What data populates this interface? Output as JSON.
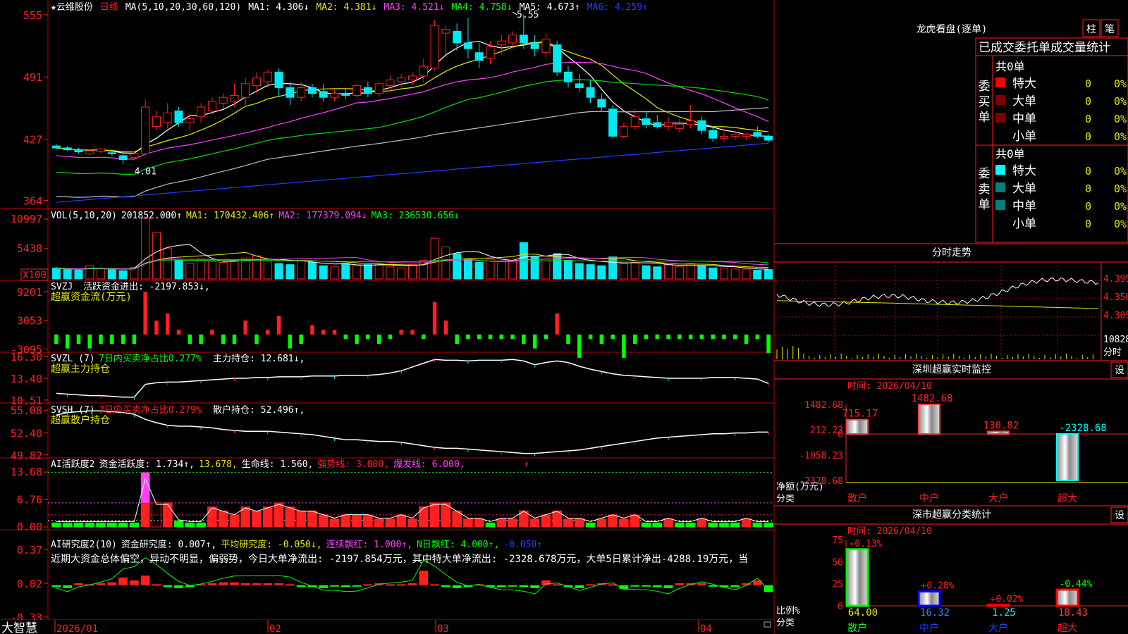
{
  "colors": {
    "up": "#ff2020",
    "down": "#00e8f0",
    "grid": "#c00000",
    "white": "#ffffff",
    "yellow": "#e8e800",
    "magenta": "#ff40ff",
    "green": "#00e000",
    "gray": "#c0c0c0",
    "blue": "#2040ff",
    "bright_green": "#00ff00"
  },
  "price_panel": {
    "title": "★云维股份",
    "period": "日线",
    "ma_head": "MA(5,10,20,30,60,120)",
    "ma1": "MA1: 4.306↓",
    "ma2": "MA2: 4.381↓",
    "ma3": "MA3: 4.521↓",
    "ma4": "MA4: 4.758↓",
    "ma5": "MA5: 4.673↑",
    "ma6": "MA6: 4.259↑",
    "high_mark": "5.55",
    "low_mark": "4.01",
    "ticks": [
      "555",
      "491",
      "427",
      "364"
    ]
  },
  "vol_panel": {
    "head": "VOL(5,10,20)",
    "value": "201852.000↑",
    "ma1": "MA1: 170432.406↑",
    "ma2": "MA2: 177379.094↓",
    "ma3": "MA3: 236530.656↓",
    "ticks": [
      "10997",
      "5430"
    ],
    "unit": "X100"
  },
  "svzj_panel": {
    "head": "SVZJ",
    "text": "活跃资金进出: -2197.853↓,",
    "sub": "超赢资金流(万元)",
    "ticks": [
      "9201",
      "3053",
      "-3095"
    ]
  },
  "svzl_panel": {
    "head": "SVZL (7)",
    "text1": "7日内买卖净占比0.277%",
    "text2": "主力持仓: 12.681↓,",
    "sub": "超赢主力持仓",
    "ticks": [
      "16.30",
      "13.40",
      "10.51"
    ]
  },
  "svsh_panel": {
    "head": "SVSH (7)",
    "text1": "7日内买卖净占比0.279%",
    "text2": "散户持仓: 52.496↑,",
    "sub": "超赢散户持仓",
    "ticks": [
      "55.08",
      "52.40",
      "49.82"
    ]
  },
  "ai_panel": {
    "head": "AI活跃度2",
    "t1": "资金活跃度: 1.734↑,",
    "t2": "13.678,",
    "t3": "生命线: 1.560,",
    "t4": "强势线: 3.000,",
    "t5": "爆发线: 6.000,",
    "ticks": [
      "13.68",
      "6.76",
      "0.00"
    ]
  },
  "ai2_panel": {
    "head": "AI研究度2(10)",
    "t1": "资金研究度: 0.007↑,",
    "t2": "平均研究度: -0.050↓,",
    "t3": "连续飘红: 1.000↑,",
    "t4": "N日飘红: 4.000↑,",
    "t5": "-0.050↑",
    "desc": "近期大资金总体偏空，异动不明显，偏弱势，今日大单净流出: -2197.854万元，其中特大单净流出: -2328.678万元，大单5日累计净出-4288.19万元，当",
    "ticks": [
      "0.37",
      "0.02",
      "-0.33"
    ]
  },
  "bottom": {
    "logo": "大智慧",
    "dates": [
      "2026/01",
      "02",
      "03",
      "04"
    ]
  },
  "lhb": {
    "title": "龙虎看盘(逐单)",
    "btn1": "柱",
    "btn2": "笔",
    "subtitle": "已成交委托单成交量统计",
    "buy": {
      "label": "委买单",
      "total": "共0单",
      "rows": [
        {
          "name": "特大",
          "v": "0",
          "p": "0%"
        },
        {
          "name": "大单",
          "v": "0",
          "p": "0%"
        },
        {
          "name": "中单",
          "v": "0",
          "p": "0%"
        },
        {
          "name": "小单",
          "v": "0",
          "p": "0%"
        }
      ]
    },
    "sell": {
      "label": "委卖单",
      "total": "共0单",
      "rows": [
        {
          "name": "特大",
          "v": "0",
          "p": "0%"
        },
        {
          "name": "大单",
          "v": "0",
          "p": "0%"
        },
        {
          "name": "中单",
          "v": "0",
          "p": "0%"
        },
        {
          "name": "小单",
          "v": "0",
          "p": "0%"
        }
      ]
    }
  },
  "intraday": {
    "title": "分时走势",
    "ticks": [
      "4.395",
      "4.350",
      "4.305"
    ],
    "vol_tick": "10828",
    "unit": "分时"
  },
  "sz_monitor": {
    "title": "深圳超赢实时监控",
    "set": "设",
    "time": "时间: 2026/04/10",
    "ylabel": "净额(万元)",
    "xlabel": "分类",
    "ticks": [
      "1482.68",
      "212.23",
      "0",
      "-1058.23",
      "-2328.68"
    ],
    "cats": [
      "散户",
      "中户",
      "大户",
      "超大"
    ],
    "labels": [
      "715.17",
      "1482.68",
      "130.82",
      "-2328.68"
    ]
  },
  "sz_class": {
    "title": "深市超赢分类统计",
    "set": "设",
    "time": "时间: 2026/04/10",
    "ylabel": "比例%",
    "xlabel": "分类",
    "ticks": [
      "75",
      "50",
      "25",
      "0"
    ],
    "cats": [
      "散户",
      "中户",
      "大户",
      "超大"
    ],
    "top_labels": [
      "+0.13%",
      "+0.28%",
      "+0.02%",
      "-0.44%"
    ],
    "bottom_labels": [
      "64.00",
      "16.32",
      "1.25",
      "18.43"
    ]
  },
  "chart_data": [
    {
      "type": "candlestick",
      "name": "price",
      "ohlc": [
        [
          4.2,
          4.22,
          4.17,
          4.18
        ],
        [
          4.18,
          4.2,
          4.15,
          4.16
        ],
        [
          4.16,
          4.18,
          4.12,
          4.14
        ],
        [
          4.12,
          4.16,
          4.1,
          4.15
        ],
        [
          4.14,
          4.18,
          4.12,
          4.17
        ],
        [
          4.13,
          4.16,
          4.1,
          4.12
        ],
        [
          4.1,
          4.12,
          4.01,
          4.06
        ],
        [
          4.08,
          4.14,
          4.06,
          4.12
        ],
        [
          4.12,
          4.68,
          4.1,
          4.6
        ],
        [
          4.4,
          4.56,
          4.36,
          4.5
        ],
        [
          4.44,
          4.64,
          4.38,
          4.54
        ],
        [
          4.56,
          4.6,
          4.4,
          4.44
        ],
        [
          4.44,
          4.54,
          4.36,
          4.48
        ],
        [
          4.5,
          4.64,
          4.44,
          4.6
        ],
        [
          4.56,
          4.7,
          4.52,
          4.66
        ],
        [
          4.64,
          4.74,
          4.58,
          4.7
        ],
        [
          4.66,
          4.84,
          4.6,
          4.72
        ],
        [
          4.7,
          4.9,
          4.62,
          4.84
        ],
        [
          4.82,
          4.96,
          4.74,
          4.9
        ],
        [
          4.86,
          4.98,
          4.8,
          4.96
        ],
        [
          4.96,
          5.0,
          4.7,
          4.8
        ],
        [
          4.8,
          4.86,
          4.62,
          4.7
        ],
        [
          4.7,
          4.86,
          4.66,
          4.8
        ],
        [
          4.8,
          4.84,
          4.7,
          4.74
        ],
        [
          4.76,
          4.84,
          4.66,
          4.7
        ],
        [
          4.7,
          4.78,
          4.66,
          4.74
        ],
        [
          4.74,
          4.8,
          4.68,
          4.72
        ],
        [
          4.72,
          4.84,
          4.7,
          4.82
        ],
        [
          4.8,
          4.86,
          4.7,
          4.74
        ],
        [
          4.74,
          4.86,
          4.7,
          4.84
        ],
        [
          4.82,
          4.92,
          4.76,
          4.88
        ],
        [
          4.86,
          4.94,
          4.8,
          4.9
        ],
        [
          4.88,
          4.96,
          4.82,
          4.92
        ],
        [
          4.92,
          5.1,
          4.86,
          5.02
        ],
        [
          5.0,
          5.5,
          4.98,
          5.44
        ],
        [
          5.36,
          5.44,
          5.14,
          5.4
        ],
        [
          5.38,
          5.46,
          5.18,
          5.26
        ],
        [
          5.26,
          5.52,
          5.1,
          5.2
        ],
        [
          5.16,
          5.26,
          5.0,
          5.08
        ],
        [
          5.1,
          5.28,
          5.04,
          5.22
        ],
        [
          5.24,
          5.34,
          5.14,
          5.28
        ],
        [
          5.26,
          5.38,
          5.2,
          5.34
        ],
        [
          5.34,
          5.55,
          5.2,
          5.26
        ],
        [
          5.26,
          5.34,
          5.12,
          5.2
        ],
        [
          5.16,
          5.36,
          5.1,
          5.3
        ],
        [
          5.24,
          5.28,
          4.92,
          4.96
        ],
        [
          4.96,
          5.02,
          4.8,
          4.86
        ],
        [
          4.84,
          4.94,
          4.76,
          4.8
        ],
        [
          4.8,
          4.88,
          4.64,
          4.7
        ],
        [
          4.68,
          4.74,
          4.56,
          4.6
        ],
        [
          4.58,
          4.62,
          4.28,
          4.3
        ],
        [
          4.3,
          4.44,
          4.28,
          4.4
        ],
        [
          4.4,
          4.58,
          4.36,
          4.5
        ],
        [
          4.48,
          4.56,
          4.38,
          4.42
        ],
        [
          4.44,
          4.52,
          4.38,
          4.4
        ],
        [
          4.4,
          4.5,
          4.36,
          4.44
        ],
        [
          4.38,
          4.48,
          4.34,
          4.42
        ],
        [
          4.42,
          4.62,
          4.38,
          4.46
        ],
        [
          4.46,
          4.5,
          4.32,
          4.36
        ],
        [
          4.36,
          4.4,
          4.24,
          4.28
        ],
        [
          4.28,
          4.34,
          4.24,
          4.3
        ],
        [
          4.3,
          4.36,
          4.26,
          4.32
        ],
        [
          4.3,
          4.34,
          4.26,
          4.32
        ],
        [
          4.34,
          4.4,
          4.28,
          4.3
        ],
        [
          4.3,
          4.32,
          4.24,
          4.26
        ]
      ],
      "ma_last": {
        "MA1": 4.306,
        "MA2": 4.381,
        "MA3": 4.521,
        "MA4": 4.758,
        "MA5": 4.673,
        "MA6": 4.259
      },
      "ylim": [
        3.6,
        5.6
      ]
    },
    {
      "type": "bar",
      "name": "volume",
      "values": [
        2.0,
        1.8,
        1.6,
        2.4,
        1.9,
        1.7,
        1.5,
        2.1,
        11.0,
        8.4,
        5.6,
        3.4,
        2.8,
        3.6,
        3.2,
        3.0,
        3.4,
        3.8,
        4.2,
        3.6,
        2.8,
        2.6,
        3.4,
        3.0,
        2.4,
        2.2,
        2.8,
        2.4,
        2.6,
        2.8,
        2.2,
        2.0,
        2.6,
        3.4,
        7.4,
        5.8,
        4.6,
        3.6,
        3.0,
        3.6,
        3.2,
        3.4,
        6.6,
        4.0,
        3.6,
        4.6,
        3.4,
        2.8,
        2.6,
        2.4,
        4.0,
        2.8,
        3.0,
        2.4,
        2.2,
        2.6,
        2.2,
        2.8,
        2.4,
        2.0,
        2.0,
        1.8,
        1.8,
        1.6,
        1.7
      ],
      "ylim": [
        0,
        11.5
      ]
    },
    {
      "type": "bar",
      "name": "svzj",
      "values": [
        -2,
        -3,
        -2,
        -3,
        -2,
        -2,
        -2,
        -2,
        9.2,
        3,
        4.5,
        1,
        -2,
        -2,
        1,
        -2,
        -2,
        3,
        -2,
        1,
        4,
        -3,
        -2,
        2,
        1,
        1,
        -1,
        -2,
        -1,
        -2,
        -1,
        1,
        1,
        -1,
        7,
        3,
        -2,
        -1,
        -1,
        -1,
        -1,
        -1,
        -2,
        -3,
        -1,
        4.5,
        -2,
        -5,
        -1,
        -2,
        -1,
        -5,
        -2,
        -1,
        -1,
        -1,
        -1,
        -1,
        -1,
        -1,
        -1,
        -1,
        -2,
        -1,
        -4
      ],
      "ylim": [
        -3.5,
        9.5
      ]
    },
    {
      "type": "line",
      "name": "svzl",
      "values": [
        11.4,
        11.3,
        11.2,
        11.1,
        11.1,
        11.0,
        10.9,
        10.9,
        12.6,
        12.8,
        12.9,
        12.9,
        13.0,
        13.1,
        13.2,
        13.3,
        13.4,
        13.4,
        13.5,
        13.5,
        13.6,
        13.6,
        13.6,
        13.7,
        13.7,
        13.7,
        13.8,
        13.8,
        13.8,
        13.9,
        14.1,
        14.4,
        14.9,
        15.4,
        15.9,
        15.8,
        15.8,
        15.7,
        15.8,
        15.8,
        15.8,
        15.9,
        15.7,
        15.2,
        15.5,
        15.7,
        15.5,
        15.0,
        14.6,
        14.3,
        14.0,
        13.8,
        13.7,
        13.6,
        13.5,
        13.4,
        13.4,
        13.4,
        13.4,
        13.5,
        13.5,
        13.5,
        13.4,
        13.3,
        12.7
      ],
      "ylim": [
        10.5,
        16.3
      ]
    },
    {
      "type": "line",
      "name": "svsh",
      "values": [
        54.5,
        54.8,
        54.9,
        55.0,
        55.0,
        54.9,
        54.8,
        54.6,
        54.0,
        53.6,
        53.3,
        53.2,
        53.2,
        53.1,
        53.0,
        52.8,
        52.7,
        52.6,
        52.6,
        52.6,
        52.5,
        52.4,
        52.3,
        52.2,
        52.0,
        51.8,
        51.6,
        51.6,
        51.5,
        51.4,
        51.4,
        51.3,
        51.1,
        50.9,
        50.7,
        50.6,
        50.6,
        50.5,
        50.4,
        50.3,
        50.2,
        50.1,
        50.0,
        50.0,
        50.1,
        50.2,
        50.3,
        50.4,
        50.6,
        50.8,
        51.0,
        51.2,
        51.4,
        51.6,
        51.8,
        51.9,
        52.0,
        52.1,
        52.2,
        52.3,
        52.3,
        52.4,
        52.4,
        52.5,
        52.5
      ],
      "ylim": [
        49.8,
        55.1
      ]
    },
    {
      "type": "bar",
      "name": "ai_activity",
      "values": [
        1,
        1,
        1,
        1,
        1,
        1,
        1,
        1,
        13.6,
        6,
        6,
        1.5,
        1,
        1,
        5,
        4,
        3,
        5,
        4,
        5,
        6,
        5,
        4,
        4,
        3,
        2,
        3,
        3,
        3,
        2,
        2,
        3,
        2,
        5,
        6,
        6,
        4,
        2,
        2,
        1,
        2,
        2,
        4,
        2,
        3,
        4,
        2,
        2,
        1,
        2,
        3,
        2,
        3,
        1,
        1,
        2,
        1,
        1,
        2,
        1,
        1,
        1,
        2,
        1,
        1
      ],
      "lines": {
        "life": 1.56,
        "strong": 3.0,
        "burst": 6.0
      },
      "ylim": [
        0,
        13.7
      ]
    },
    {
      "type": "bar",
      "name": "ai_research",
      "values": [
        -0.02,
        -0.03,
        0.02,
        0.01,
        0.02,
        0.03,
        0.08,
        0.05,
        0.1,
        0.01,
        -0.02,
        -0.03,
        -0.02,
        0.01,
        0.02,
        0.03,
        0.03,
        0.02,
        0.02,
        0.02,
        0.02,
        0.01,
        -0.02,
        -0.02,
        -0.03,
        -0.01,
        -0.02,
        -0.01,
        0.01,
        0.02,
        0.01,
        0.01,
        0.02,
        0.15,
        0.01,
        -0.02,
        -0.03,
        -0.02,
        0.01,
        -0.02,
        -0.02,
        -0.01,
        -0.02,
        -0.03,
        0.05,
        0.01,
        -0.02,
        -0.03,
        0.01,
        0.02,
        0.01,
        -0.04,
        -0.01,
        -0.01,
        -0.02,
        -0.03,
        0.02,
        0.02,
        0.02,
        -0.01,
        -0.02,
        -0.02,
        0.02,
        0.05,
        -0.07
      ],
      "ylim": [
        -0.33,
        0.37
      ]
    },
    {
      "type": "bar",
      "name": "sz_net",
      "categories": [
        "散户",
        "中户",
        "大户",
        "超大"
      ],
      "values": [
        715.17,
        1482.68,
        130.82,
        -2328.68
      ],
      "ylim": [
        -2328.68,
        1482.68
      ]
    },
    {
      "type": "bar",
      "name": "sz_ratio",
      "categories": [
        "散户",
        "中户",
        "大户",
        "超大"
      ],
      "values": [
        64.0,
        16.32,
        1.25,
        18.43
      ],
      "changes": [
        "+0.13%",
        "+0.28%",
        "+0.02%",
        "-0.44%"
      ],
      "ylim": [
        0,
        75
      ]
    }
  ]
}
